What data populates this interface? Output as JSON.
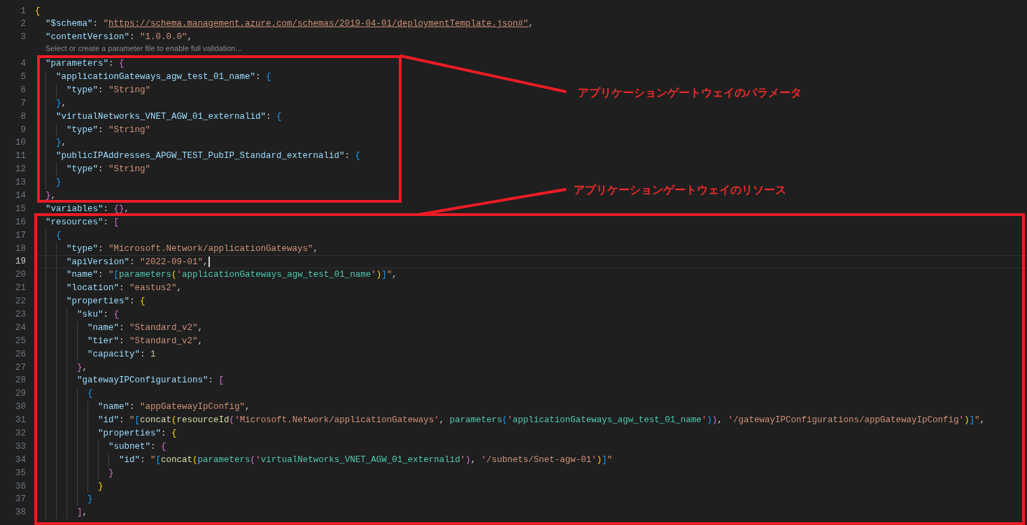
{
  "editor": {
    "lines": [
      {
        "kind": "code",
        "number": "1",
        "current": false,
        "tokens": [
          {
            "kind": "bracket1",
            "text": "{"
          }
        ]
      },
      {
        "kind": "code",
        "number": "2",
        "current": false,
        "tokens": [
          {
            "kind": "key",
            "text": "\"$schema\""
          },
          {
            "kind": "punct",
            "text": ": "
          },
          {
            "kind": "string",
            "text": "\""
          },
          {
            "kind": "link",
            "text": "https://schema.management.azure.com/schemas/2019-04-01/deploymentTemplate.json#\""
          },
          {
            "kind": "punct",
            "text": ","
          }
        ]
      },
      {
        "kind": "code",
        "number": "3",
        "current": false,
        "tokens": [
          {
            "kind": "key",
            "text": "\"contentVersion\""
          },
          {
            "kind": "punct",
            "text": ": "
          },
          {
            "kind": "string",
            "text": "\"1.0.0.0\""
          },
          {
            "kind": "punct",
            "text": ","
          }
        ]
      },
      {
        "kind": "codelens",
        "text": "Select or create a parameter file to enable full validation..."
      },
      {
        "kind": "code",
        "number": "4",
        "current": false,
        "tokens": [
          {
            "kind": "key",
            "text": "\"parameters\""
          },
          {
            "kind": "punct",
            "text": ": "
          },
          {
            "kind": "bracket2",
            "text": "{"
          }
        ]
      },
      {
        "kind": "code",
        "number": "5",
        "current": false,
        "tokens": [
          {
            "kind": "key",
            "text": "\"applicationGateways_agw_test_01_name\""
          },
          {
            "kind": "punct",
            "text": ": "
          },
          {
            "kind": "bracket3",
            "text": "{"
          }
        ]
      },
      {
        "kind": "code",
        "number": "6",
        "current": false,
        "tokens": [
          {
            "kind": "key",
            "text": "\"type\""
          },
          {
            "kind": "punct",
            "text": ": "
          },
          {
            "kind": "string",
            "text": "\"String\""
          }
        ]
      },
      {
        "kind": "code",
        "number": "7",
        "current": false,
        "tokens": [
          {
            "kind": "bracket3",
            "text": "}"
          },
          {
            "kind": "punct",
            "text": ","
          }
        ]
      },
      {
        "kind": "code",
        "number": "8",
        "current": false,
        "tokens": [
          {
            "kind": "key",
            "text": "\"virtualNetworks_VNET_AGW_01_externalid\""
          },
          {
            "kind": "punct",
            "text": ": "
          },
          {
            "kind": "bracket3",
            "text": "{"
          }
        ]
      },
      {
        "kind": "code",
        "number": "9",
        "current": false,
        "tokens": [
          {
            "kind": "key",
            "text": "\"type\""
          },
          {
            "kind": "punct",
            "text": ": "
          },
          {
            "kind": "string",
            "text": "\"String\""
          }
        ]
      },
      {
        "kind": "code",
        "number": "10",
        "current": false,
        "tokens": [
          {
            "kind": "bracket3",
            "text": "}"
          },
          {
            "kind": "punct",
            "text": ","
          }
        ]
      },
      {
        "kind": "code",
        "number": "11",
        "current": false,
        "tokens": [
          {
            "kind": "key",
            "text": "\"publicIPAddresses_APGW_TEST_PubIP_Standard_externalid\""
          },
          {
            "kind": "punct",
            "text": ": "
          },
          {
            "kind": "bracket3",
            "text": "{"
          }
        ]
      },
      {
        "kind": "code",
        "number": "12",
        "current": false,
        "tokens": [
          {
            "kind": "key",
            "text": "\"type\""
          },
          {
            "kind": "punct",
            "text": ": "
          },
          {
            "kind": "string",
            "text": "\"String\""
          }
        ]
      },
      {
        "kind": "code",
        "number": "13",
        "current": false,
        "tokens": [
          {
            "kind": "bracket3",
            "text": "}"
          }
        ]
      },
      {
        "kind": "code",
        "number": "14",
        "current": false,
        "tokens": [
          {
            "kind": "bracket2",
            "text": "}"
          },
          {
            "kind": "punct",
            "text": ","
          }
        ]
      },
      {
        "kind": "code",
        "number": "15",
        "current": false,
        "tokens": [
          {
            "kind": "key",
            "text": "\"variables\""
          },
          {
            "kind": "punct",
            "text": ": "
          },
          {
            "kind": "bracket2",
            "text": "{}"
          },
          {
            "kind": "punct",
            "text": ","
          }
        ]
      },
      {
        "kind": "code",
        "number": "16",
        "current": false,
        "tokens": [
          {
            "kind": "key",
            "text": "\"resources\""
          },
          {
            "kind": "punct",
            "text": ": "
          },
          {
            "kind": "bracket2",
            "text": "["
          }
        ]
      },
      {
        "kind": "code",
        "number": "17",
        "current": false,
        "tokens": [
          {
            "kind": "bracket3",
            "text": "{"
          }
        ]
      },
      {
        "kind": "code",
        "number": "18",
        "current": false,
        "tokens": [
          {
            "kind": "key",
            "text": "\"type\""
          },
          {
            "kind": "punct",
            "text": ": "
          },
          {
            "kind": "string",
            "text": "\"Microsoft.Network/applicationGateways\""
          },
          {
            "kind": "punct",
            "text": ","
          }
        ]
      },
      {
        "kind": "code",
        "number": "19",
        "current": true,
        "tokens": [
          {
            "kind": "key",
            "text": "\"apiVersion\""
          },
          {
            "kind": "punct",
            "text": ": "
          },
          {
            "kind": "string",
            "text": "\"2022-09-01\""
          },
          {
            "kind": "punct",
            "text": ","
          }
        ]
      },
      {
        "kind": "code",
        "number": "20",
        "current": false,
        "tokens": [
          {
            "kind": "key",
            "text": "\"name\""
          },
          {
            "kind": "punct",
            "text": ": "
          },
          {
            "kind": "string",
            "text": "\""
          },
          {
            "kind": "bracket3",
            "text": "["
          },
          {
            "kind": "param",
            "text": "parameters"
          },
          {
            "kind": "bracket1",
            "text": "("
          },
          {
            "kind": "quote",
            "text": "'"
          },
          {
            "kind": "param",
            "text": "applicationGateways_agw_test_01_name"
          },
          {
            "kind": "quote",
            "text": "'"
          },
          {
            "kind": "bracket1",
            "text": ")"
          },
          {
            "kind": "bracket3",
            "text": "]"
          },
          {
            "kind": "string",
            "text": "\""
          },
          {
            "kind": "punct",
            "text": ","
          }
        ]
      },
      {
        "kind": "code",
        "number": "21",
        "current": false,
        "tokens": [
          {
            "kind": "key",
            "text": "\"location\""
          },
          {
            "kind": "punct",
            "text": ": "
          },
          {
            "kind": "string",
            "text": "\"eastus2\""
          },
          {
            "kind": "punct",
            "text": ","
          }
        ]
      },
      {
        "kind": "code",
        "number": "22",
        "current": false,
        "tokens": [
          {
            "kind": "key",
            "text": "\"properties\""
          },
          {
            "kind": "punct",
            "text": ": "
          },
          {
            "kind": "bracket1",
            "text": "{"
          }
        ]
      },
      {
        "kind": "code",
        "number": "23",
        "current": false,
        "tokens": [
          {
            "kind": "key",
            "text": "\"sku\""
          },
          {
            "kind": "punct",
            "text": ": "
          },
          {
            "kind": "bracket2",
            "text": "{"
          }
        ]
      },
      {
        "kind": "code",
        "number": "24",
        "current": false,
        "tokens": [
          {
            "kind": "key",
            "text": "\"name\""
          },
          {
            "kind": "punct",
            "text": ": "
          },
          {
            "kind": "string",
            "text": "\"Standard_v2\""
          },
          {
            "kind": "punct",
            "text": ","
          }
        ]
      },
      {
        "kind": "code",
        "number": "25",
        "current": false,
        "tokens": [
          {
            "kind": "key",
            "text": "\"tier\""
          },
          {
            "kind": "punct",
            "text": ": "
          },
          {
            "kind": "string",
            "text": "\"Standard_v2\""
          },
          {
            "kind": "punct",
            "text": ","
          }
        ]
      },
      {
        "kind": "code",
        "number": "26",
        "current": false,
        "tokens": [
          {
            "kind": "key",
            "text": "\"capacity\""
          },
          {
            "kind": "punct",
            "text": ": "
          },
          {
            "kind": "number",
            "text": "1"
          }
        ]
      },
      {
        "kind": "code",
        "number": "27",
        "current": false,
        "tokens": [
          {
            "kind": "bracket2",
            "text": "}"
          },
          {
            "kind": "punct",
            "text": ","
          }
        ]
      },
      {
        "kind": "code",
        "number": "28",
        "current": false,
        "tokens": [
          {
            "kind": "key",
            "text": "\"gatewayIPConfigurations\""
          },
          {
            "kind": "punct",
            "text": ": "
          },
          {
            "kind": "bracket2",
            "text": "["
          }
        ]
      },
      {
        "kind": "code",
        "number": "29",
        "current": false,
        "tokens": [
          {
            "kind": "bracket3",
            "text": "{"
          }
        ]
      },
      {
        "kind": "code",
        "number": "30",
        "current": false,
        "tokens": [
          {
            "kind": "key",
            "text": "\"name\""
          },
          {
            "kind": "punct",
            "text": ": "
          },
          {
            "kind": "string",
            "text": "\"appGatewayIpConfig\""
          },
          {
            "kind": "punct",
            "text": ","
          }
        ]
      },
      {
        "kind": "code",
        "number": "31",
        "current": false,
        "tokens": [
          {
            "kind": "key",
            "text": "\"id\""
          },
          {
            "kind": "punct",
            "text": ": "
          },
          {
            "kind": "string",
            "text": "\""
          },
          {
            "kind": "bracket3",
            "text": "["
          },
          {
            "kind": "function",
            "text": "concat"
          },
          {
            "kind": "bracket1",
            "text": "("
          },
          {
            "kind": "function",
            "text": "resourceId"
          },
          {
            "kind": "bracket2",
            "text": "("
          },
          {
            "kind": "quote",
            "text": "'"
          },
          {
            "kind": "string",
            "text": "Microsoft.Network/applicationGateways"
          },
          {
            "kind": "quote",
            "text": "'"
          },
          {
            "kind": "punct",
            "text": ", "
          },
          {
            "kind": "param",
            "text": "parameters"
          },
          {
            "kind": "bracket3",
            "text": "("
          },
          {
            "kind": "quote",
            "text": "'"
          },
          {
            "kind": "param",
            "text": "applicationGateways_agw_test_01_name"
          },
          {
            "kind": "quote",
            "text": "'"
          },
          {
            "kind": "bracket3",
            "text": ")"
          },
          {
            "kind": "bracket2",
            "text": ")"
          },
          {
            "kind": "punct",
            "text": ", "
          },
          {
            "kind": "quote",
            "text": "'"
          },
          {
            "kind": "string",
            "text": "/gatewayIPConfigurations/appGatewayIpConfig"
          },
          {
            "kind": "quote",
            "text": "'"
          },
          {
            "kind": "bracket1",
            "text": ")"
          },
          {
            "kind": "bracket3",
            "text": "]"
          },
          {
            "kind": "string",
            "text": "\""
          },
          {
            "kind": "punct",
            "text": ","
          }
        ]
      },
      {
        "kind": "code",
        "number": "32",
        "current": false,
        "tokens": [
          {
            "kind": "key",
            "text": "\"properties\""
          },
          {
            "kind": "punct",
            "text": ": "
          },
          {
            "kind": "bracket1",
            "text": "{"
          }
        ]
      },
      {
        "kind": "code",
        "number": "33",
        "current": false,
        "tokens": [
          {
            "kind": "key",
            "text": "\"subnet\""
          },
          {
            "kind": "punct",
            "text": ": "
          },
          {
            "kind": "bracket2",
            "text": "{"
          }
        ]
      },
      {
        "kind": "code",
        "number": "34",
        "current": false,
        "tokens": [
          {
            "kind": "key",
            "text": "\"id\""
          },
          {
            "kind": "punct",
            "text": ": "
          },
          {
            "kind": "string",
            "text": "\""
          },
          {
            "kind": "bracket3",
            "text": "["
          },
          {
            "kind": "function",
            "text": "concat"
          },
          {
            "kind": "bracket1",
            "text": "("
          },
          {
            "kind": "param",
            "text": "parameters"
          },
          {
            "kind": "bracket2",
            "text": "("
          },
          {
            "kind": "quote",
            "text": "'"
          },
          {
            "kind": "param",
            "text": "virtualNetworks_VNET_AGW_01_externalid"
          },
          {
            "kind": "quote",
            "text": "'"
          },
          {
            "kind": "bracket2",
            "text": ")"
          },
          {
            "kind": "punct",
            "text": ", "
          },
          {
            "kind": "quote",
            "text": "'"
          },
          {
            "kind": "string",
            "text": "/subnets/Snet-agw-01"
          },
          {
            "kind": "quote",
            "text": "'"
          },
          {
            "kind": "bracket1",
            "text": ")"
          },
          {
            "kind": "bracket3",
            "text": "]"
          },
          {
            "kind": "string",
            "text": "\""
          }
        ]
      },
      {
        "kind": "code",
        "number": "35",
        "current": false,
        "tokens": [
          {
            "kind": "bracket2",
            "text": "}"
          }
        ]
      },
      {
        "kind": "code",
        "number": "36",
        "current": false,
        "tokens": [
          {
            "kind": "bracket1",
            "text": "}"
          }
        ]
      },
      {
        "kind": "code",
        "number": "37",
        "current": false,
        "tokens": [
          {
            "kind": "bracket3",
            "text": "}"
          }
        ]
      },
      {
        "kind": "code",
        "number": "38",
        "current": false,
        "tokens": [
          {
            "kind": "bracket2",
            "text": "]"
          },
          {
            "kind": "punct",
            "text": ","
          }
        ]
      }
    ]
  },
  "annotations": [
    {
      "label": "アプリケーションゲートウェイのパラメータ"
    },
    {
      "label": "アプリケーションゲートウェイのリソース"
    }
  ]
}
